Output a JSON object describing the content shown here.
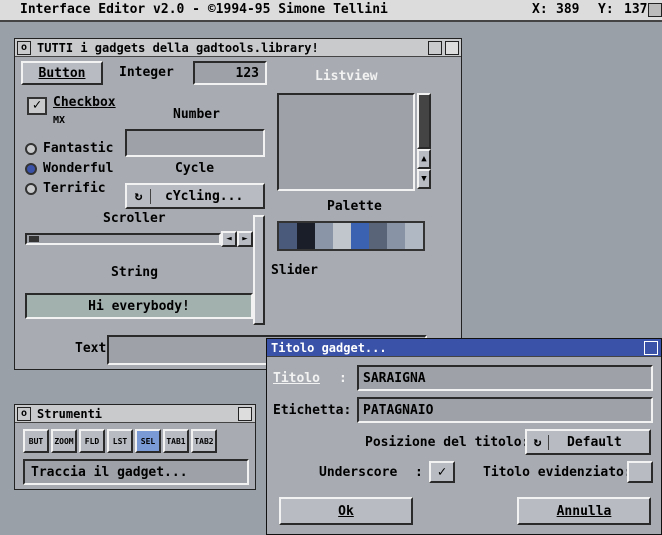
{
  "screen": {
    "title": "Interface Editor v2.0 - ©1994-95 Simone Tellini",
    "x_label": "X:",
    "x_value": "389",
    "y_label": "Y:",
    "y_value": "137"
  },
  "main_window": {
    "title": "TUTTI i gadgets della gadtools.library!",
    "button_label": "Button",
    "integer_label": "Integer",
    "integer_value": "123",
    "checkbox_label": "Checkbox",
    "mx_label": "MX",
    "mx_options": [
      "Fantastic",
      "Wonderful",
      "Terrific"
    ],
    "number_label": "Number",
    "cycle_label": "Cycle",
    "cycle_value": "cYcling...",
    "listview_label": "Listview",
    "palette_label": "Palette",
    "scroller_label": "Scroller",
    "slider_label": "Slider",
    "string_label": "String",
    "string_value": "Hi everybody!",
    "text_label": "Text",
    "palette_colors": [
      "#4a5a7a",
      "#1a1e28",
      "#8a96a8",
      "#c0c6cc",
      "#3a62b0",
      "#5a6478",
      "#8894a6",
      "#b0b8c4"
    ]
  },
  "tools_window": {
    "title": "Strumenti",
    "tool_icons": [
      "BUT",
      "ZOOM",
      "FLD",
      "LST",
      "SEL",
      "TAB1",
      "TAB2"
    ],
    "status_text": "Traccia il gadget..."
  },
  "dialog": {
    "title": "Titolo gadget...",
    "titolo_label": "Titolo",
    "titolo_value": "SARAIGNA",
    "etichetta_label": "Etichetta:",
    "etichetta_value": "PATAGNAIO",
    "position_label": "Posizione del titolo:",
    "position_value": "Default",
    "underscore_label": "Underscore",
    "colon": ":",
    "highlight_label": "Titolo evidenziato:",
    "ok_label": "Ok",
    "cancel_label": "Annulla"
  }
}
